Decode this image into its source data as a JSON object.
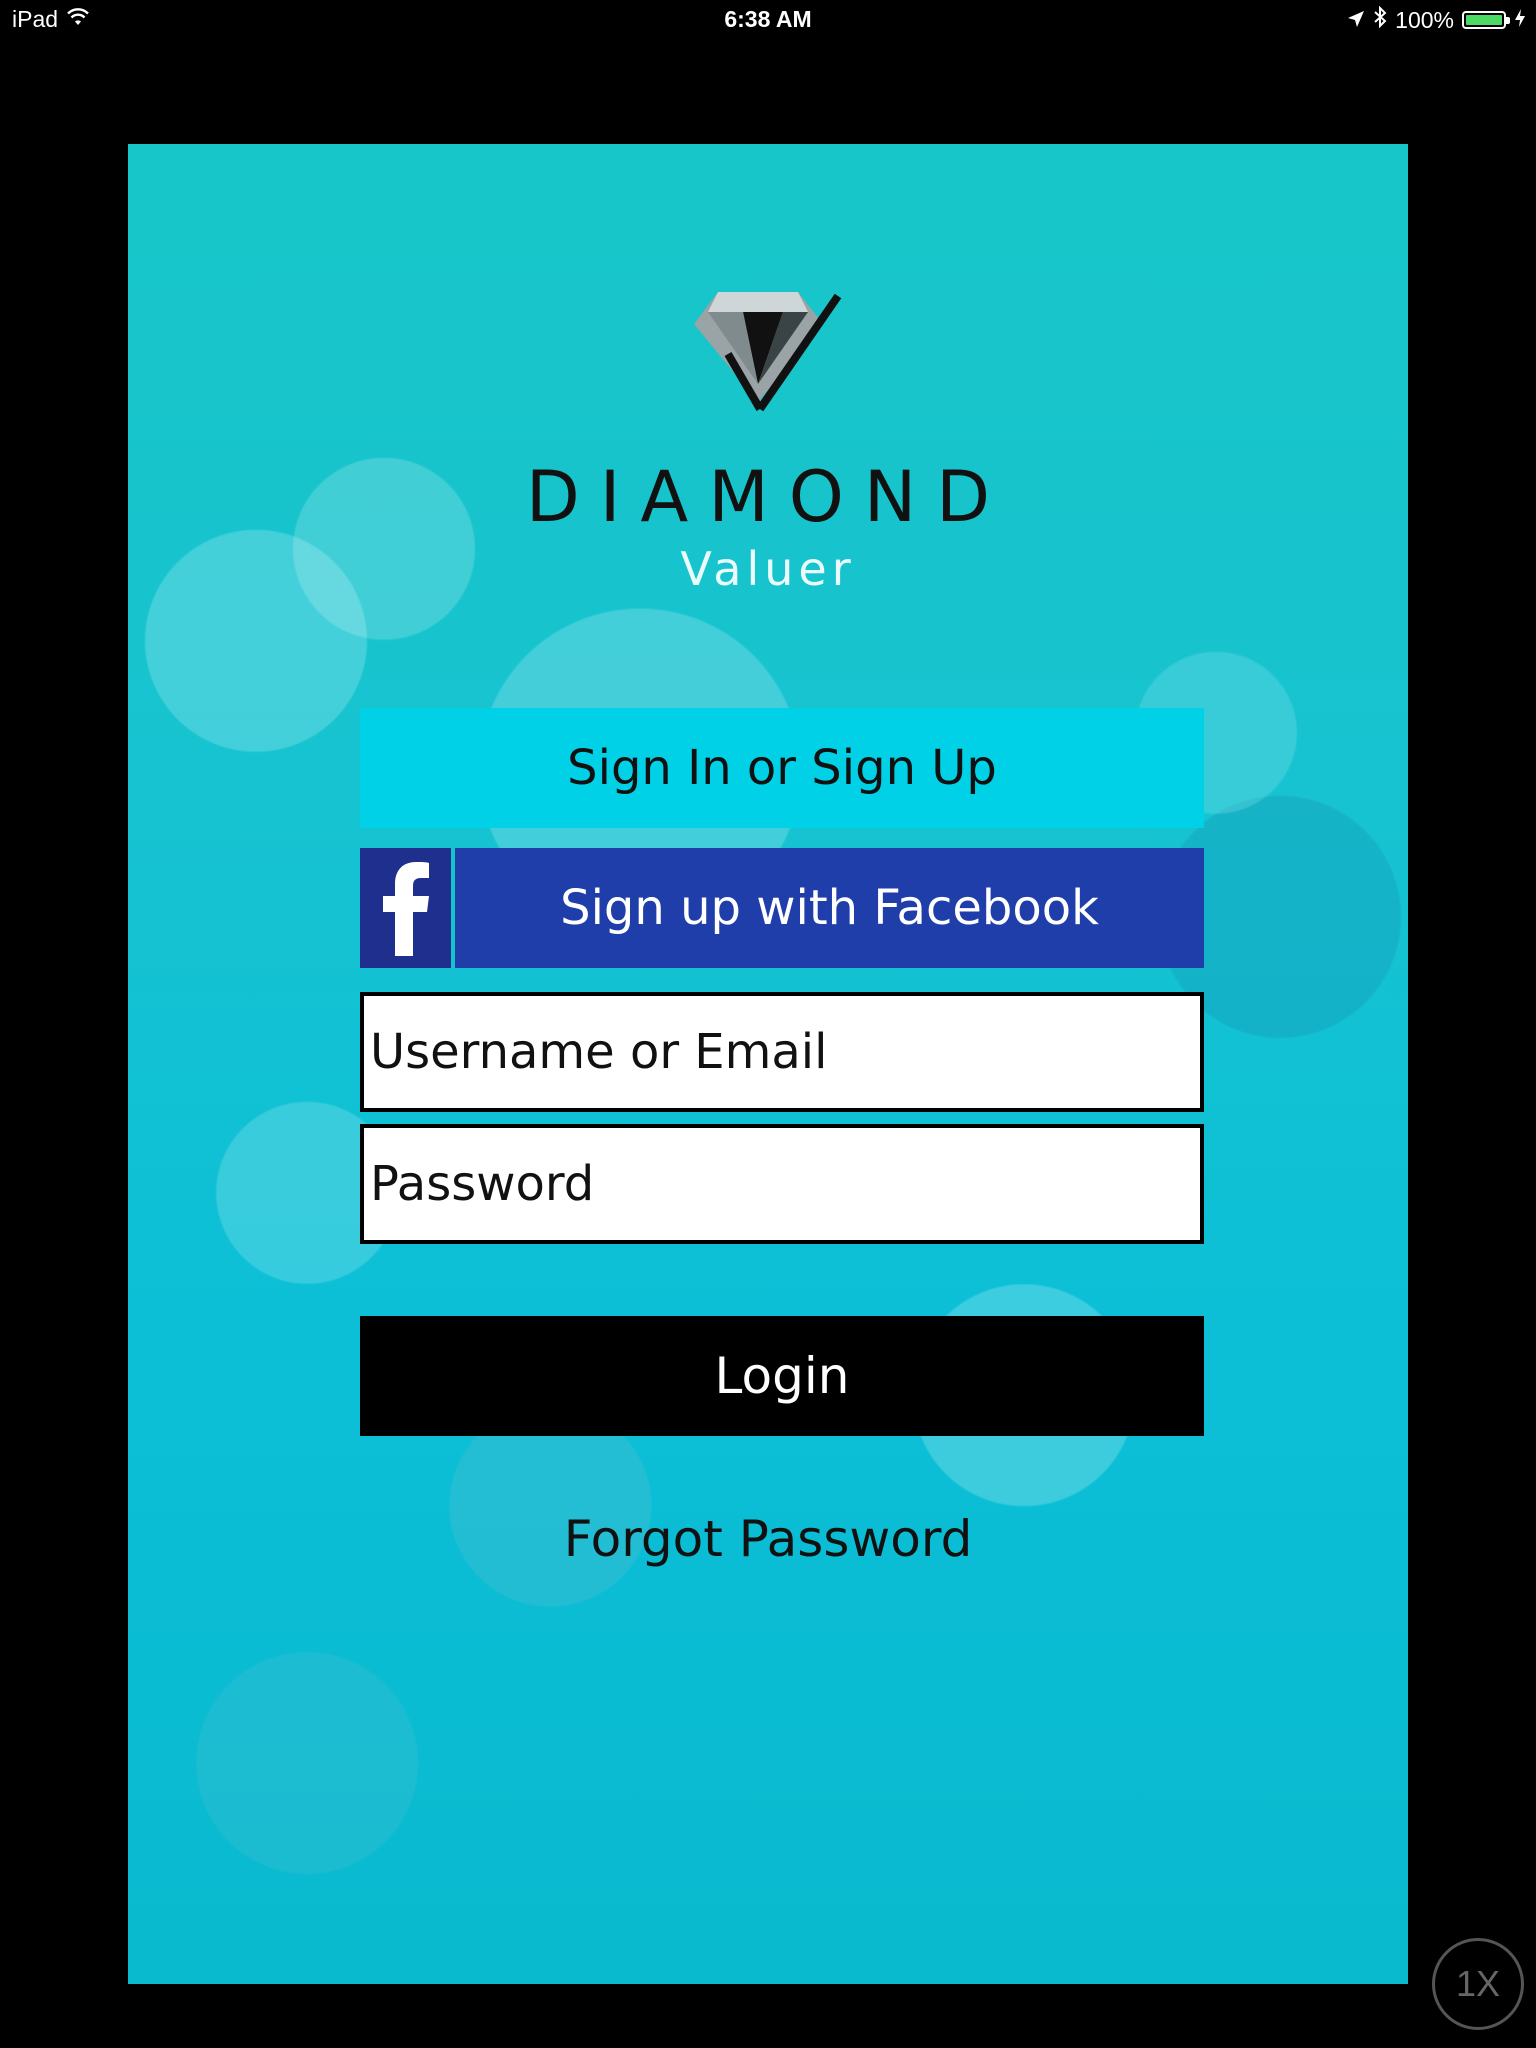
{
  "status_bar": {
    "device": "iPad",
    "time": "6:38 AM",
    "battery": "100%",
    "icons": [
      "wifi-icon",
      "location-arrow-icon",
      "bluetooth-icon",
      "battery-icon",
      "charging-bolt-icon"
    ]
  },
  "logo": {
    "icon": "diamond-logo-icon",
    "brand": "DIAMOND",
    "subtitle": "Valuer"
  },
  "form": {
    "signin_signup_label": "Sign In or Sign Up",
    "facebook_label": "Sign up with Facebook",
    "facebook_icon": "facebook-f-icon",
    "username_placeholder": "Username or Email",
    "password_placeholder": "Password",
    "login_label": "Login",
    "forgot_label": "Forgot Password"
  },
  "zoom_badge": "1X",
  "colors": {
    "background_teal": "#17c3d0",
    "signup_button": "#00d1e6",
    "facebook_blue": "#1f3eaa",
    "facebook_icon_bg": "#1e2f8d",
    "login_button": "#000000"
  }
}
